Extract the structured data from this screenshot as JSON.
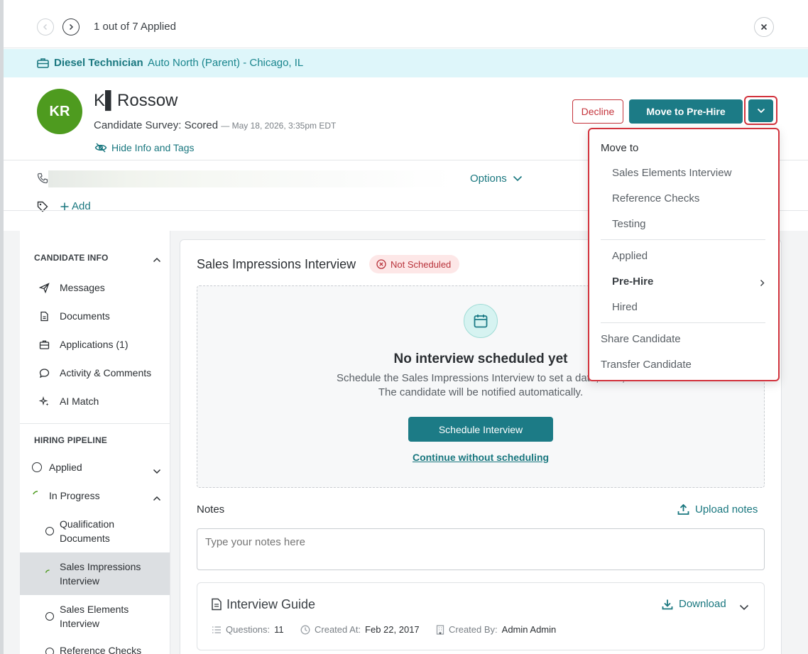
{
  "topbar": {
    "counter": "1 out of 7 Applied"
  },
  "job": {
    "title": "Diesel Technician",
    "location": "Auto North (Parent) - Chicago, IL"
  },
  "candidate": {
    "initials": "KR",
    "name": "K▌Rossow",
    "survey": "Candidate Survey: Scored",
    "survey_date": "— May 18, 2026, 3:35pm EDT",
    "hide_info": "Hide Info and Tags",
    "options": "Options",
    "add_tag": "Add"
  },
  "actions": {
    "decline": "Decline",
    "move": "Move to Pre-Hire"
  },
  "menu": {
    "heading": "Move to",
    "group1": [
      "Sales Elements Interview",
      "Reference Checks",
      "Testing"
    ],
    "group2": {
      "applied": "Applied",
      "prehire": "Pre-Hire",
      "hired": "Hired"
    },
    "group3": [
      "Share Candidate",
      "Transfer Candidate"
    ]
  },
  "sidebar": {
    "info_heading": "CANDIDATE INFO",
    "info_items": [
      "Messages",
      "Documents",
      "Applications (1)",
      "Activity & Comments",
      "AI Match"
    ],
    "pipeline_heading": "HIRING PIPELINE",
    "applied": "Applied",
    "in_progress": "In Progress",
    "sub": {
      "qual1": "Qualification",
      "qual2": "Documents",
      "sii1": "Sales Impressions",
      "sii2": "Interview",
      "sei1": "Sales Elements",
      "sei2": "Interview",
      "ref": "Reference Checks"
    }
  },
  "main": {
    "title": "Sales Impressions Interview",
    "badge": "Not Scheduled",
    "empty_title": "No interview scheduled yet",
    "empty_desc1": "Schedule the Sales Impressions Interview to set a date, time,",
    "empty_desc2": "The candidate will be notified automatically.",
    "schedule_btn": "Schedule Interview",
    "continue_link": "Continue without scheduling",
    "notes_label": "Notes",
    "upload_notes": "Upload notes",
    "notes_placeholder": "Type your notes here"
  },
  "guide": {
    "title": "Interview Guide",
    "download": "Download",
    "questions_label": "Questions:",
    "questions_value": "11",
    "created_at_label": "Created At:",
    "created_at_value": "Feb 22, 2017",
    "created_by_label": "Created By:",
    "created_by_value": "Admin Admin"
  },
  "colors": {
    "accent": "#1c7b86",
    "link": "#19777f",
    "danger": "#c4323a",
    "banner": "#def6fa",
    "avatar": "#4e9b1f"
  }
}
